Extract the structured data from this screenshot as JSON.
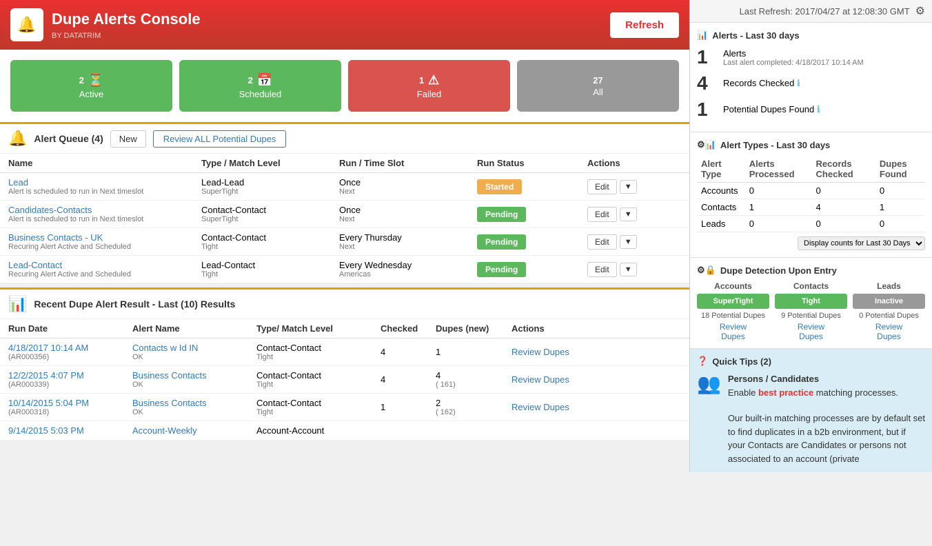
{
  "header": {
    "title": "Dupe Alerts Console",
    "subtitle": "BY DATATRIM",
    "refresh_label": "Refresh",
    "last_refresh": "Last Refresh: 2017/04/27 at 12:08:30 GMT"
  },
  "stat_cards": [
    {
      "number": "2",
      "label": "Active",
      "color": "green",
      "icon": "⏳"
    },
    {
      "number": "2",
      "label": "Scheduled",
      "color": "green-sched",
      "icon": "📅"
    },
    {
      "number": "1",
      "label": "Failed",
      "color": "red",
      "icon": "⚠"
    },
    {
      "number": "27",
      "label": "All",
      "color": "gray",
      "icon": ""
    }
  ],
  "alert_queue": {
    "title": "Alert Queue (4)",
    "btn_new": "New",
    "btn_review": "Review ALL Potential Dupes",
    "columns": [
      "Name",
      "Type / Match Level",
      "Run / Time Slot",
      "Run Status",
      "Actions"
    ],
    "rows": [
      {
        "name": "Lead",
        "sub": "Alert is scheduled to run in Next timeslot",
        "type": "Lead-Lead",
        "match": "SuperTight",
        "run": "Once",
        "slot": "Next",
        "status": "Started",
        "status_class": "started"
      },
      {
        "name": "Candidates-Contacts",
        "sub": "Alert is scheduled to run in Next timeslot",
        "type": "Contact-Contact",
        "match": "SuperTight",
        "run": "Once",
        "slot": "Next",
        "status": "Pending",
        "status_class": "pending"
      },
      {
        "name": "Business Contacts - UK",
        "sub": "Recuring Alert Active and Scheduled",
        "type": "Contact-Contact",
        "match": "Tight",
        "run": "Every Thursday",
        "slot": "Next",
        "status": "Pending",
        "status_class": "pending"
      },
      {
        "name": "Lead-Contact",
        "sub": "Recuring Alert Active and Scheduled",
        "type": "Lead-Contact",
        "match": "Tight",
        "run": "Every Wednesday",
        "slot": "Americas",
        "status": "Pending",
        "status_class": "pending"
      }
    ]
  },
  "results_section": {
    "title": "Recent Dupe Alert Result - Last (10) Results",
    "columns": [
      "Run Date",
      "Alert Name",
      "Type/ Match Level",
      "Checked",
      "Dupes (new)",
      "Actions"
    ],
    "rows": [
      {
        "date": "4/18/2017 10:14 AM",
        "date_sub": "(AR000356)",
        "alert_name": "Contacts w Id IN",
        "alert_sub": "OK",
        "type": "Contact-Contact",
        "match": "Tight",
        "checked": "4",
        "dupes": "1",
        "dupes_sub": "",
        "action": "Review Dupes"
      },
      {
        "date": "12/2/2015 4:07 PM",
        "date_sub": "(AR000339)",
        "alert_name": "Business Contacts",
        "alert_sub": "OK",
        "type": "Contact-Contact",
        "match": "Tight",
        "checked": "4",
        "dupes": "4",
        "dupes_sub": "( 161)",
        "action": "Review Dupes"
      },
      {
        "date": "10/14/2015 5:04 PM",
        "date_sub": "(AR000318)",
        "alert_name": "Business Contacts",
        "alert_sub": "OK",
        "type": "Contact-Contact",
        "match": "Tight",
        "checked": "1",
        "dupes": "2",
        "dupes_sub": "( 162)",
        "action": "Review Dupes"
      },
      {
        "date": "9/14/2015 5:03 PM",
        "date_sub": "",
        "alert_name": "Account-Weekly",
        "alert_sub": "",
        "type": "Account-Account",
        "match": "",
        "checked": "",
        "dupes": "",
        "dupes_sub": "",
        "action": ""
      }
    ]
  },
  "right_panel": {
    "last_refresh": "Last Refresh: 2017/04/27 at 12:08:30 GMT",
    "alerts_section": {
      "title": "Alerts - Last 30 days",
      "stats": [
        {
          "number": "1",
          "label": "Alerts",
          "sub": "Last alert completed: 4/18/2017 10:14 AM"
        },
        {
          "number": "4",
          "label": "Records Checked",
          "has_info": true,
          "sub": ""
        },
        {
          "number": "1",
          "label": "Potential Dupes Found",
          "has_info": true,
          "sub": ""
        }
      ]
    },
    "alert_types": {
      "title": "Alert Types - Last 30 days",
      "columns": [
        "Alert Type",
        "Alerts Processed",
        "Records Checked",
        "Dupes Found"
      ],
      "rows": [
        {
          "type": "Accounts",
          "alerts": "0",
          "records": "0",
          "dupes": "0"
        },
        {
          "type": "Contacts",
          "alerts": "1",
          "records": "4",
          "dupes": "1"
        },
        {
          "type": "Leads",
          "alerts": "0",
          "records": "0",
          "dupes": "0"
        }
      ],
      "select_label": "Display counts for Last 30 Days"
    },
    "dupe_detection": {
      "title": "Dupe Detection Upon Entry",
      "columns": [
        {
          "label": "Accounts",
          "btn_label": "SuperTight",
          "btn_class": "green",
          "potential": "18 Potential Dupes",
          "review": "Review",
          "dupes": "Dupes"
        },
        {
          "label": "Contacts",
          "btn_label": "Tight",
          "btn_class": "green",
          "potential": "9 Potential Dupes",
          "review": "Review",
          "dupes": "Dupes"
        },
        {
          "label": "Leads",
          "btn_label": "Inactive",
          "btn_class": "gray",
          "potential": "0 Potential Dupes",
          "review": "Review",
          "dupes": "Dupes"
        }
      ]
    },
    "quick_tips": {
      "title": "Quick Tips (2)",
      "heading": "Persons / Candidates",
      "body1": "Enable ",
      "highlight1": "best practice",
      "body2": " matching processes.",
      "body3": "Our built-in matching processes are by default set to find duplicates in a b2b environment, but if your Contacts are Candidates or persons not associated to an account (private"
    }
  }
}
